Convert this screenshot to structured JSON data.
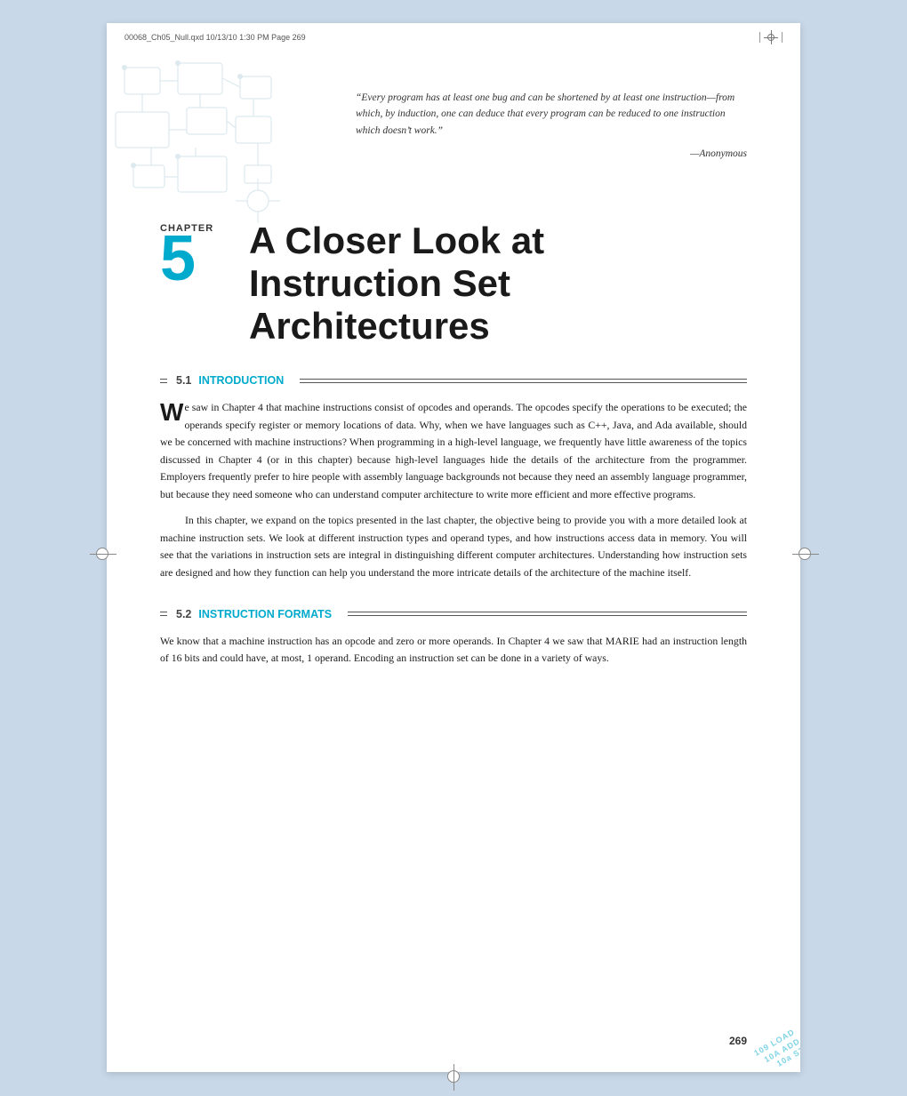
{
  "file_header": {
    "text": "00068_Ch05_Null.qxd  10/13/10  1:30 PM  Page 269"
  },
  "quote": {
    "text": "“Every program has at least one bug and can be shortened by at least one instruction—from which, by induction, one can deduce that every program can be reduced to one instruction which doesn’t work.”",
    "attribution": "—Anonymous"
  },
  "chapter": {
    "label": "CHAPTER",
    "number": "5",
    "title": "A Closer Look at Instruction Set Architectures"
  },
  "section_51": {
    "number": "5.1",
    "label": "INTRODUCTION",
    "body_paragraph1": "e saw in Chapter 4 that machine instructions consist of opcodes and operands. The opcodes specify the operations to be executed; the operands specify register or memory locations of data. Why, when we have languages such as C++, Java, and Ada available, should we be concerned with machine instructions? When programming in a high-level language, we frequently have little awareness of the topics discussed in Chapter 4 (or in this chapter) because high-level languages hide the details of the architecture from the programmer. Employers frequently prefer to hire people with assembly language backgrounds not because they need an assembly language programmer, but because they need someone who can understand computer architecture to write more efficient and more effective programs.",
    "drop_cap": "W",
    "body_paragraph2": "In this chapter, we expand on the topics presented in the last chapter, the objective being to provide you with a more detailed look at machine instruction sets. We look at different instruction types and operand types, and how instructions access data in memory. You will see that the variations in instruction sets are integral in distinguishing different computer architectures. Understanding how instruction sets are designed and how they function can help you understand the more intricate details of the architecture of the machine itself."
  },
  "section_52": {
    "number": "5.2",
    "label": "INSTRUCTION FORMATS",
    "body_paragraph1": "We know that a machine instruction has an opcode and zero or more operands. In Chapter 4 we saw that MARIE had an instruction length of 16 bits and could have, at most, 1 operand. Encoding an instruction set can be done in a variety of ways."
  },
  "page_number": "269",
  "corner_labels": [
    "LOAD",
    "ADD",
    "ST"
  ]
}
